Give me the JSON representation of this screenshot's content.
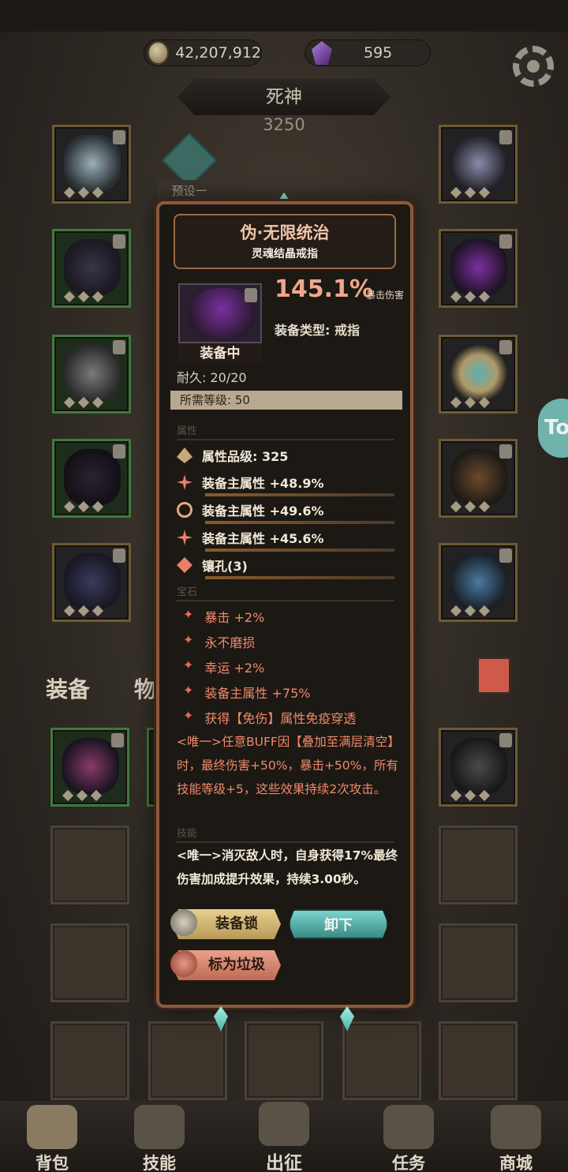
{
  "resources": {
    "gold": "42,207,912",
    "gems": "595"
  },
  "character": {
    "name": "死神",
    "power": "3250"
  },
  "preset_label": "预设一",
  "toggle_label": "To",
  "tabs": {
    "equipment": "装备",
    "items": "物品"
  },
  "nav": [
    {
      "label": "背包",
      "icon": "backpack-icon"
    },
    {
      "label": "技能",
      "icon": "skill-book-icon"
    },
    {
      "label": "出征",
      "icon": "sword-map-icon"
    },
    {
      "label": "任务",
      "icon": "scroll-icon"
    },
    {
      "label": "商城",
      "icon": "shop-crown-icon"
    }
  ],
  "item": {
    "name": "伪·无限统治",
    "subtitle": "灵魂结晶戒指",
    "damage": "145.1%",
    "damage_unit": "暴击伤害",
    "equip_type_label": "装备类型: 戒指",
    "status": "装备中",
    "durability": "耐久: 20/20",
    "required_level": "所需等级: 50",
    "sections": {
      "attributes": "属性",
      "gems": "宝石",
      "skills": "技能"
    },
    "attributes": [
      "属性品级: 325",
      "装备主属性 +48.9%",
      "装备主属性 +49.6%",
      "装备主属性 +45.6%",
      "镶孔(3)"
    ],
    "gems": [
      "暴击 +2%",
      "永不磨损",
      "幸运 +2%",
      "装备主属性 +75%",
      "获得【免伤】属性免疫穿透"
    ],
    "unique_effect": "<唯一>任意BUFF因【叠加至满层清空】时，最终伤害+50%，暴击+50%，所有技能等级+5，这些效果持续2次攻击。",
    "skill_effect": "<唯一>消灭敌人时，自身获得17%最终伤害加成提升效果，持续3.00秒。",
    "buttons": {
      "lock": "装备锁",
      "unequip": "卸下",
      "junk": "标为垃圾"
    }
  }
}
